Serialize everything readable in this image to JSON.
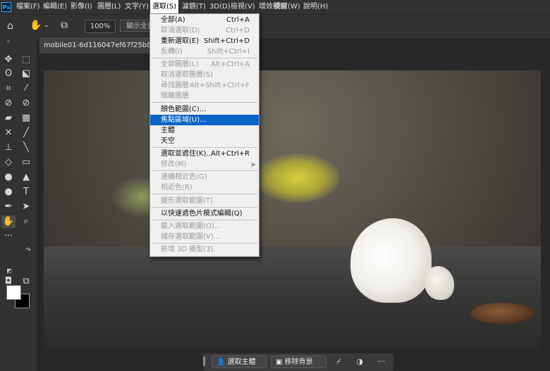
{
  "app": {
    "logo": "Ps"
  },
  "menubar": {
    "items": [
      "檔案(F)",
      "編輯(E)",
      "影像(I)",
      "圖層(L)",
      "文字(Y)",
      "選取(S)",
      "濾鏡(T)",
      "3D(D)",
      "檢視(V)",
      "增效模組",
      "視窗(W)",
      "說明(H)"
    ],
    "active": "選取(S)"
  },
  "options": {
    "zoom": "100%",
    "fit_label": "顯示全頁"
  },
  "document": {
    "tab_title": "mobile01-6d116047ef67f25b86ce7"
  },
  "select_menu": {
    "items": [
      {
        "label": "全部(A)",
        "shortcut": "Ctrl+A",
        "state": "enabled"
      },
      {
        "label": "取消選取(D)",
        "shortcut": "Ctrl+D",
        "state": "disabled"
      },
      {
        "label": "重新選取(E)",
        "shortcut": "Shift+Ctrl+D",
        "state": "enabled"
      },
      {
        "label": "反轉(I)",
        "shortcut": "Shift+Ctrl+I",
        "state": "disabled"
      },
      {
        "label": "全部圖層(L)",
        "shortcut": "Alt+Ctrl+A",
        "state": "disabled"
      },
      {
        "label": "取消選取圖層(S)",
        "shortcut": "",
        "state": "disabled"
      },
      {
        "label": "尋找圖層",
        "shortcut": "Alt+Shift+Ctrl+F",
        "state": "disabled"
      },
      {
        "label": "隔離圖層",
        "shortcut": "",
        "state": "disabled"
      },
      {
        "label": "顏色範圍(C)...",
        "shortcut": "",
        "state": "enabled"
      },
      {
        "label": "焦點區域(U)...",
        "shortcut": "",
        "state": "highlighted"
      },
      {
        "label": "主體",
        "shortcut": "",
        "state": "enabled"
      },
      {
        "label": "天空",
        "shortcut": "",
        "state": "enabled"
      },
      {
        "label": "選取並遮住(K)...",
        "shortcut": "Alt+Ctrl+R",
        "state": "enabled"
      },
      {
        "label": "修改(M)",
        "shortcut": "",
        "state": "disabled"
      },
      {
        "label": "連續相近色(G)",
        "shortcut": "",
        "state": "disabled"
      },
      {
        "label": "相近色(R)",
        "shortcut": "",
        "state": "disabled"
      },
      {
        "label": "變形選取範圍(T)",
        "shortcut": "",
        "state": "disabled"
      },
      {
        "label": "以快速遮色片模式編輯(Q)",
        "shortcut": "",
        "state": "enabled"
      },
      {
        "label": "載入選取範圍(O)...",
        "shortcut": "",
        "state": "disabled"
      },
      {
        "label": "儲存選取範圍(V)...",
        "shortcut": "",
        "state": "disabled"
      },
      {
        "label": "新增 3D 模型(3)",
        "shortcut": "",
        "state": "disabled"
      }
    ]
  },
  "taskbar": {
    "select_subject": "選取主體",
    "remove_background": "移除背景"
  },
  "colors": {
    "foreground": "#ffffff",
    "background": "#000000",
    "highlight": "#0a64c8"
  }
}
